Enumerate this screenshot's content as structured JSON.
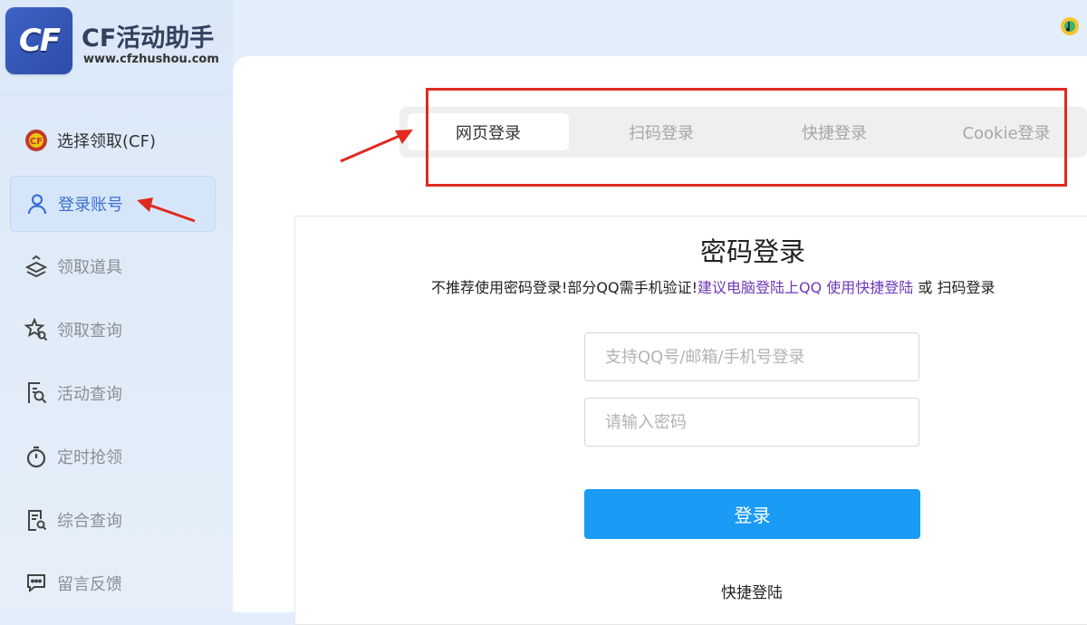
{
  "app": {
    "logo_text": "CF",
    "title": "CF活动助手",
    "url": "www.cfzhushou.com"
  },
  "sidebar": {
    "items": [
      {
        "label": "选择领取(CF)",
        "icon": "cf-game-icon"
      },
      {
        "label": "登录账号",
        "icon": "user-icon"
      },
      {
        "label": "领取道具",
        "icon": "gift-stack-icon"
      },
      {
        "label": "领取查询",
        "icon": "star-search-icon"
      },
      {
        "label": "活动查询",
        "icon": "file-search-icon"
      },
      {
        "label": "定时抢领",
        "icon": "stopwatch-icon"
      },
      {
        "label": "综合查询",
        "icon": "document-search-icon"
      },
      {
        "label": "留言反馈",
        "icon": "chat-bubble-icon"
      }
    ],
    "active_index": 1
  },
  "tabs": [
    {
      "label": "网页登录",
      "active": true
    },
    {
      "label": "扫码登录",
      "active": false
    },
    {
      "label": "快捷登录",
      "active": false
    },
    {
      "label": "Cookie登录",
      "active": false
    }
  ],
  "login": {
    "title": "密码登录",
    "notice_prefix": "不推荐使用密码登录!部分QQ需手机验证!",
    "notice_link": "建议电脑登陆上QQ 使用快捷登陆",
    "notice_mid": " 或 ",
    "notice_suffix": "扫码登录",
    "username_placeholder": "支持QQ号/邮箱/手机号登录",
    "password_placeholder": "请输入密码",
    "submit_label": "登录",
    "quick_link": "快捷登陆"
  },
  "colors": {
    "accent": "#1a9bf5",
    "active_nav": "#3b6fd1",
    "annotation_red": "#e02a20",
    "link_purple": "#6f38b8"
  }
}
